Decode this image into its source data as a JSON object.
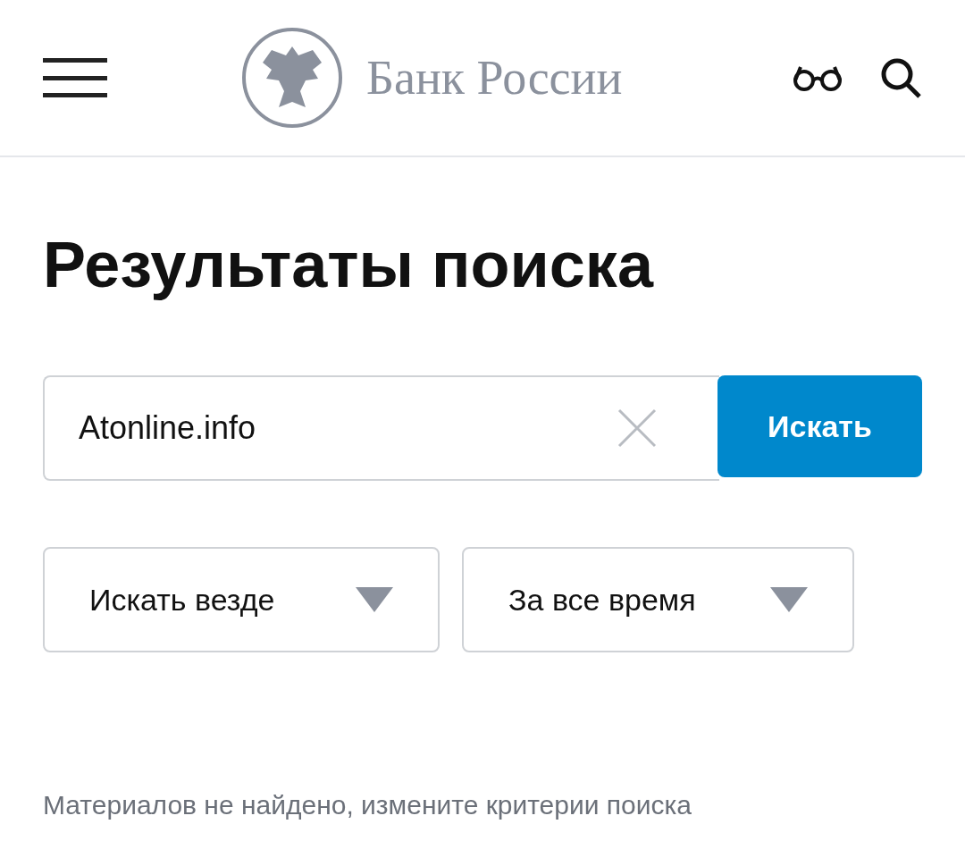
{
  "header": {
    "brand": "Банк России"
  },
  "title": "Результаты поиска",
  "search": {
    "value": "Atonline.info",
    "button": "Искать"
  },
  "filters": [
    {
      "label": "Искать везде"
    },
    {
      "label": "За все время"
    }
  ],
  "message": "Материалов не найдено, измените критерии поиска"
}
